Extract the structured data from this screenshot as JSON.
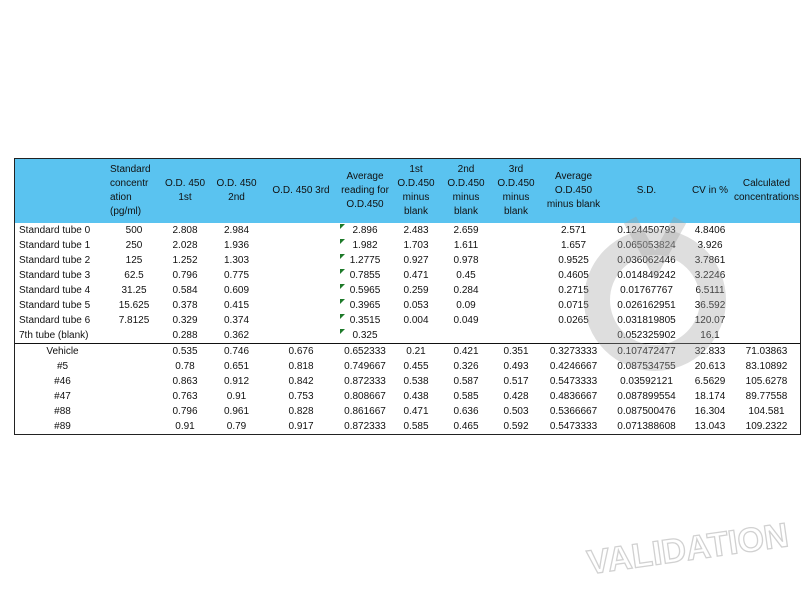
{
  "table": {
    "headers": [
      "",
      "Standard concentr ation (pg/ml)",
      "O.D. 450 1st",
      "O.D. 450 2nd",
      "O.D. 450 3rd",
      "Average reading for O.D.450",
      "1st O.D.450 minus blank",
      "2nd O.D.450 minus blank",
      "3rd O.D.450 minus blank",
      "Average O.D.450 minus blank",
      "S.D.",
      "CV in %",
      "Calculated concentrations"
    ],
    "standards": [
      {
        "label": "Standard tube 0",
        "conc": "500",
        "od1": "2.808",
        "od2": "2.984",
        "od3": "",
        "avg": "2.896",
        "m1": "2.483",
        "m2": "2.659",
        "m3": "",
        "avg_minus": "2.571",
        "sd": "0.124450793",
        "cv": "4.8406",
        "calc": ""
      },
      {
        "label": "Standard tube 1",
        "conc": "250",
        "od1": "2.028",
        "od2": "1.936",
        "od3": "",
        "avg": "1.982",
        "m1": "1.703",
        "m2": "1.611",
        "m3": "",
        "avg_minus": "1.657",
        "sd": "0.065053824",
        "cv": "3.926",
        "calc": ""
      },
      {
        "label": "Standard tube 2",
        "conc": "125",
        "od1": "1.252",
        "od2": "1.303",
        "od3": "",
        "avg": "1.2775",
        "m1": "0.927",
        "m2": "0.978",
        "m3": "",
        "avg_minus": "0.9525",
        "sd": "0.036062446",
        "cv": "3.7861",
        "calc": ""
      },
      {
        "label": "Standard tube 3",
        "conc": "62.5",
        "od1": "0.796",
        "od2": "0.775",
        "od3": "",
        "avg": "0.7855",
        "m1": "0.471",
        "m2": "0.45",
        "m3": "",
        "avg_minus": "0.4605",
        "sd": "0.014849242",
        "cv": "3.2246",
        "calc": ""
      },
      {
        "label": "Standard tube 4",
        "conc": "31.25",
        "od1": "0.584",
        "od2": "0.609",
        "od3": "",
        "avg": "0.5965",
        "m1": "0.259",
        "m2": "0.284",
        "m3": "",
        "avg_minus": "0.2715",
        "sd": "0.01767767",
        "cv": "6.5111",
        "calc": ""
      },
      {
        "label": "Standard tube 5",
        "conc": "15.625",
        "od1": "0.378",
        "od2": "0.415",
        "od3": "",
        "avg": "0.3965",
        "m1": "0.053",
        "m2": "0.09",
        "m3": "",
        "avg_minus": "0.0715",
        "sd": "0.026162951",
        "cv": "36.592",
        "calc": ""
      },
      {
        "label": "Standard tube 6",
        "conc": "7.8125",
        "od1": "0.329",
        "od2": "0.374",
        "od3": "",
        "avg": "0.3515",
        "m1": "0.004",
        "m2": "0.049",
        "m3": "",
        "avg_minus": "0.0265",
        "sd": "0.031819805",
        "cv": "120.07",
        "calc": ""
      },
      {
        "label": "7th tube (blank)",
        "conc": "",
        "od1": "0.288",
        "od2": "0.362",
        "od3": "",
        "avg": "0.325",
        "m1": "",
        "m2": "",
        "m3": "",
        "avg_minus": "",
        "sd": "0.052325902",
        "cv": "16.1",
        "calc": ""
      }
    ],
    "samples": [
      {
        "label": "Vehicle",
        "conc": "",
        "od1": "0.535",
        "od2": "0.746",
        "od3": "0.676",
        "avg": "0.652333",
        "m1": "0.21",
        "m2": "0.421",
        "m3": "0.351",
        "avg_minus": "0.3273333",
        "sd": "0.107472477",
        "cv": "32.833",
        "calc": "71.03863"
      },
      {
        "label": "#5",
        "conc": "",
        "od1": "0.78",
        "od2": "0.651",
        "od3": "0.818",
        "avg": "0.749667",
        "m1": "0.455",
        "m2": "0.326",
        "m3": "0.493",
        "avg_minus": "0.4246667",
        "sd": "0.087534755",
        "cv": "20.613",
        "calc": "83.10892"
      },
      {
        "label": "#46",
        "conc": "",
        "od1": "0.863",
        "od2": "0.912",
        "od3": "0.842",
        "avg": "0.872333",
        "m1": "0.538",
        "m2": "0.587",
        "m3": "0.517",
        "avg_minus": "0.5473333",
        "sd": "0.03592121",
        "cv": "6.5629",
        "calc": "105.6278"
      },
      {
        "label": "#47",
        "conc": "",
        "od1": "0.763",
        "od2": "0.91",
        "od3": "0.753",
        "avg": "0.808667",
        "m1": "0.438",
        "m2": "0.585",
        "m3": "0.428",
        "avg_minus": "0.4836667",
        "sd": "0.087899554",
        "cv": "18.174",
        "calc": "89.77558"
      },
      {
        "label": "#88",
        "conc": "",
        "od1": "0.796",
        "od2": "0.961",
        "od3": "0.828",
        "avg": "0.861667",
        "m1": "0.471",
        "m2": "0.636",
        "m3": "0.503",
        "avg_minus": "0.5366667",
        "sd": "0.087500476",
        "cv": "16.304",
        "calc": "104.581"
      },
      {
        "label": "#89",
        "conc": "",
        "od1": "0.91",
        "od2": "0.79",
        "od3": "0.917",
        "avg": "0.872333",
        "m1": "0.585",
        "m2": "0.465",
        "m3": "0.592",
        "avg_minus": "0.5473333",
        "sd": "0.071388608",
        "cv": "13.043",
        "calc": "109.2322"
      }
    ]
  },
  "watermark": {
    "text": "VALIDATION",
    "color": "#9a9a9a"
  },
  "colors": {
    "header_bg": "#5ac3f0",
    "flag": "#1e7a2a"
  }
}
